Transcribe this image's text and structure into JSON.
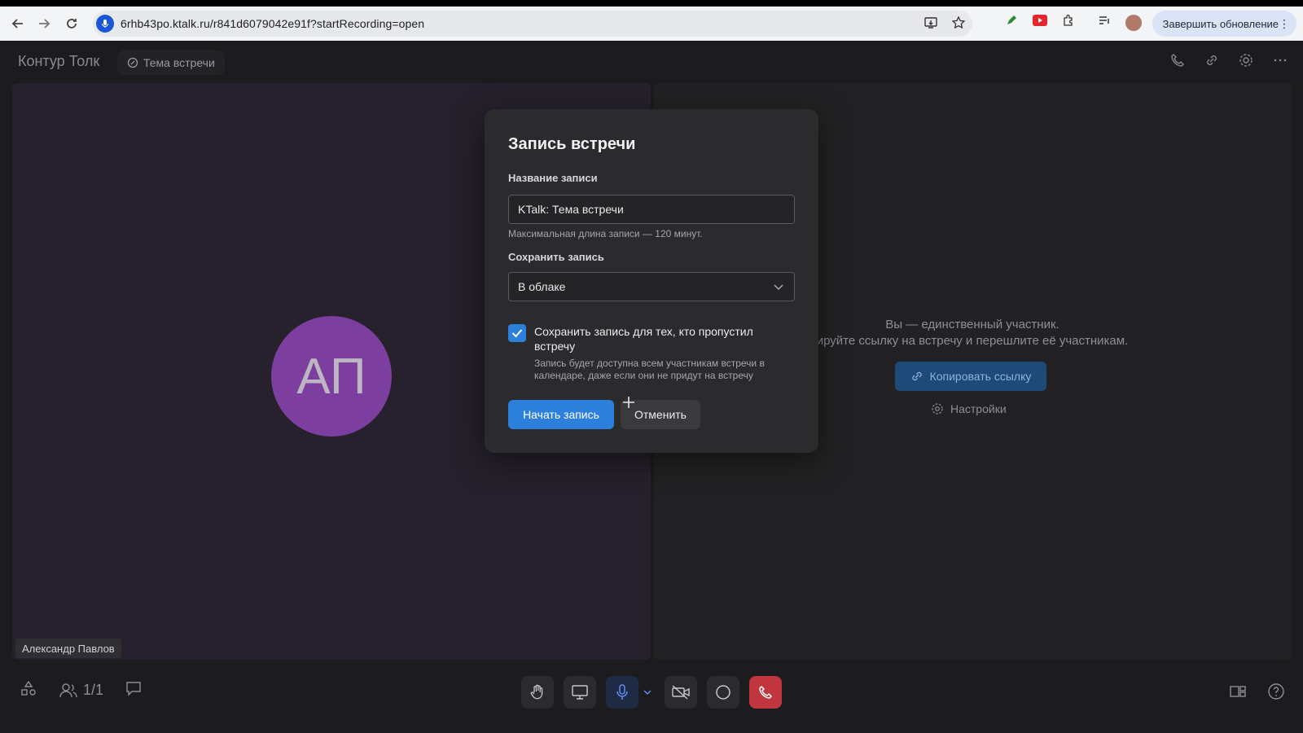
{
  "browser": {
    "url": "6rhb43po.ktalk.ru/r841d6079042e91f?startRecording=open",
    "update_button": "Завершить обновление",
    "icons": [
      "back-icon",
      "forward-icon",
      "reload-icon",
      "install-icon",
      "star-icon",
      "pen-icon",
      "youtube-icon",
      "extensions-icon",
      "playlist-icon",
      "profile-avatar",
      "more-icon"
    ]
  },
  "app": {
    "brand": "Контур Толк",
    "meeting_topic": "Тема встречи"
  },
  "left_tile": {
    "initials": "АП",
    "participant_name": "Александр Павлов",
    "avatar_color": "#7c3fa0"
  },
  "right_tile": {
    "line1": "Вы — единственный участник.",
    "line2": "ируйте ссылку на встречу и перешлите её участникам.",
    "copy_link": "Копировать ссылку",
    "settings": "Настройки"
  },
  "bottom": {
    "participants_count": "1/1"
  },
  "dialog": {
    "title": "Запись встречи",
    "name_label": "Название записи",
    "name_value": "KTalk: Тема встречи",
    "hint": "Максимальная длина записи — 120 минут.",
    "save_label": "Сохранить запись",
    "save_value": "В облаке",
    "checkbox_checked": true,
    "checkbox_label": "Сохранить запись для тех, кто пропустил встречу",
    "checkbox_sub": "Запись будет доступна всем участникам встречи в календаре, даже если они не придут на встречу",
    "start_button": "Начать запись",
    "cancel_button": "Отменить"
  },
  "colors": {
    "accent": "#2d7fdc",
    "hangup": "#c0353e",
    "background": "#1c1c1e"
  }
}
